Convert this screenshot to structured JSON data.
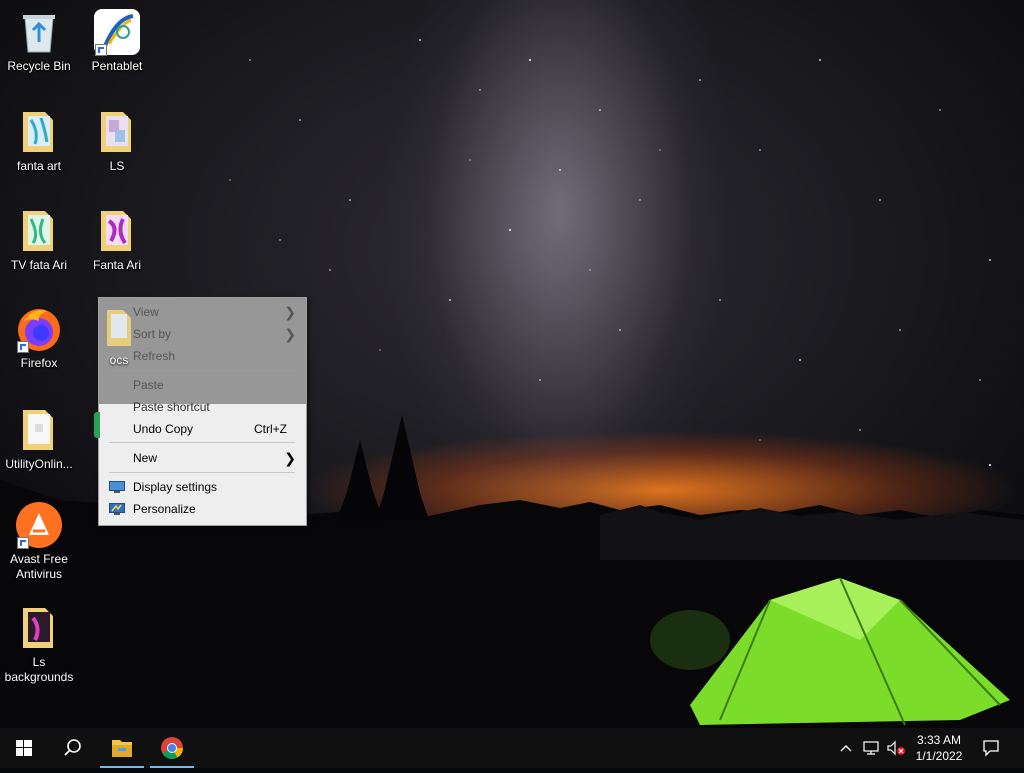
{
  "desktop": {
    "icons": [
      {
        "label": "Recycle Bin"
      },
      {
        "label": "Pentablet"
      },
      {
        "label": "fanta art"
      },
      {
        "label": "LS"
      },
      {
        "label": "TV  fata Ari"
      },
      {
        "label": "Fanta Ari"
      },
      {
        "label": "Firefox"
      },
      {
        "label": "ocs"
      },
      {
        "label": "UtilityOnlin..."
      },
      {
        "label": "Avast Free Antivirus"
      },
      {
        "label": "Ls backgrounds"
      }
    ]
  },
  "context_menu": {
    "items": [
      {
        "label": "View",
        "submenu": true
      },
      {
        "label": "Sort by",
        "submenu": true
      },
      {
        "label": "Refresh"
      },
      {
        "label": "Paste",
        "disabled": true
      },
      {
        "label": "Paste shortcut",
        "disabled": true
      },
      {
        "label": "Undo Copy",
        "shortcut": "Ctrl+Z"
      },
      {
        "label": "New",
        "submenu": true
      },
      {
        "label": "Display settings",
        "icon": "display-icon"
      },
      {
        "label": "Personalize",
        "icon": "personalize-icon"
      }
    ]
  },
  "taskbar": {
    "apps": [
      {
        "name": "file-explorer-icon",
        "active": true
      },
      {
        "name": "chrome-icon",
        "active": true
      }
    ],
    "tray": {
      "icons": [
        "chevron-up-icon",
        "network-icon",
        "volume-muted-icon"
      ],
      "time": "3:33 AM",
      "date": "1/1/2022"
    }
  },
  "colors": {
    "taskbar_bg": "#101010",
    "active_indicator": "#76b9ed",
    "menu_bg": "#eeeeee",
    "tent_green": "#7bdc2a"
  }
}
